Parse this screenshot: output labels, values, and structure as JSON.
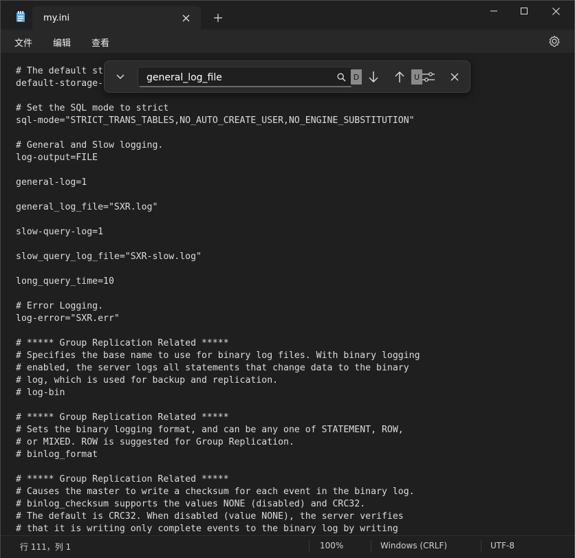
{
  "window": {
    "tab_title": "my.ini",
    "new_tab_symbol": "+",
    "controls": {
      "minimize": "minimize-icon",
      "maximize": "maximize-icon",
      "close": "close-icon"
    }
  },
  "menu": {
    "items": [
      "文件",
      "编辑",
      "查看"
    ],
    "settings_icon": "gear-icon"
  },
  "find": {
    "value": "general_log_file",
    "placeholder": "",
    "match_case_badge": "D",
    "regex_badge": "U"
  },
  "editor": {
    "lines": [
      "# The default st",
      "default-storage-",
      "",
      "# Set the SQL mode to strict",
      "sql-mode=\"STRICT_TRANS_TABLES,NO_AUTO_CREATE_USER,NO_ENGINE_SUBSTITUTION\"",
      "",
      "# General and Slow logging.",
      "log-output=FILE",
      "",
      "general-log=1",
      "",
      "general_log_file=\"SXR.log\"",
      "",
      "slow-query-log=1",
      "",
      "slow_query_log_file=\"SXR-slow.log\"",
      "",
      "long_query_time=10",
      "",
      "# Error Logging.",
      "log-error=\"SXR.err\"",
      "",
      "# ***** Group Replication Related *****",
      "# Specifies the base name to use for binary log files. With binary logging",
      "# enabled, the server logs all statements that change data to the binary",
      "# log, which is used for backup and replication.",
      "# log-bin",
      "",
      "# ***** Group Replication Related *****",
      "# Sets the binary logging format, and can be any one of STATEMENT, ROW,",
      "# or MIXED. ROW is suggested for Group Replication.",
      "# binlog_format",
      "",
      "# ***** Group Replication Related *****",
      "# Causes the master to write a checksum for each event in the binary log.",
      "# binlog_checksum supports the values NONE (disabled) and CRC32.",
      "# The default is CRC32. When disabled (value NONE), the server verifies",
      "# that it is writing only complete events to the binary log by writing"
    ]
  },
  "status": {
    "position": "行 111，列 1",
    "zoom": "100%",
    "line_ending": "Windows (CRLF)",
    "encoding": "UTF-8"
  }
}
